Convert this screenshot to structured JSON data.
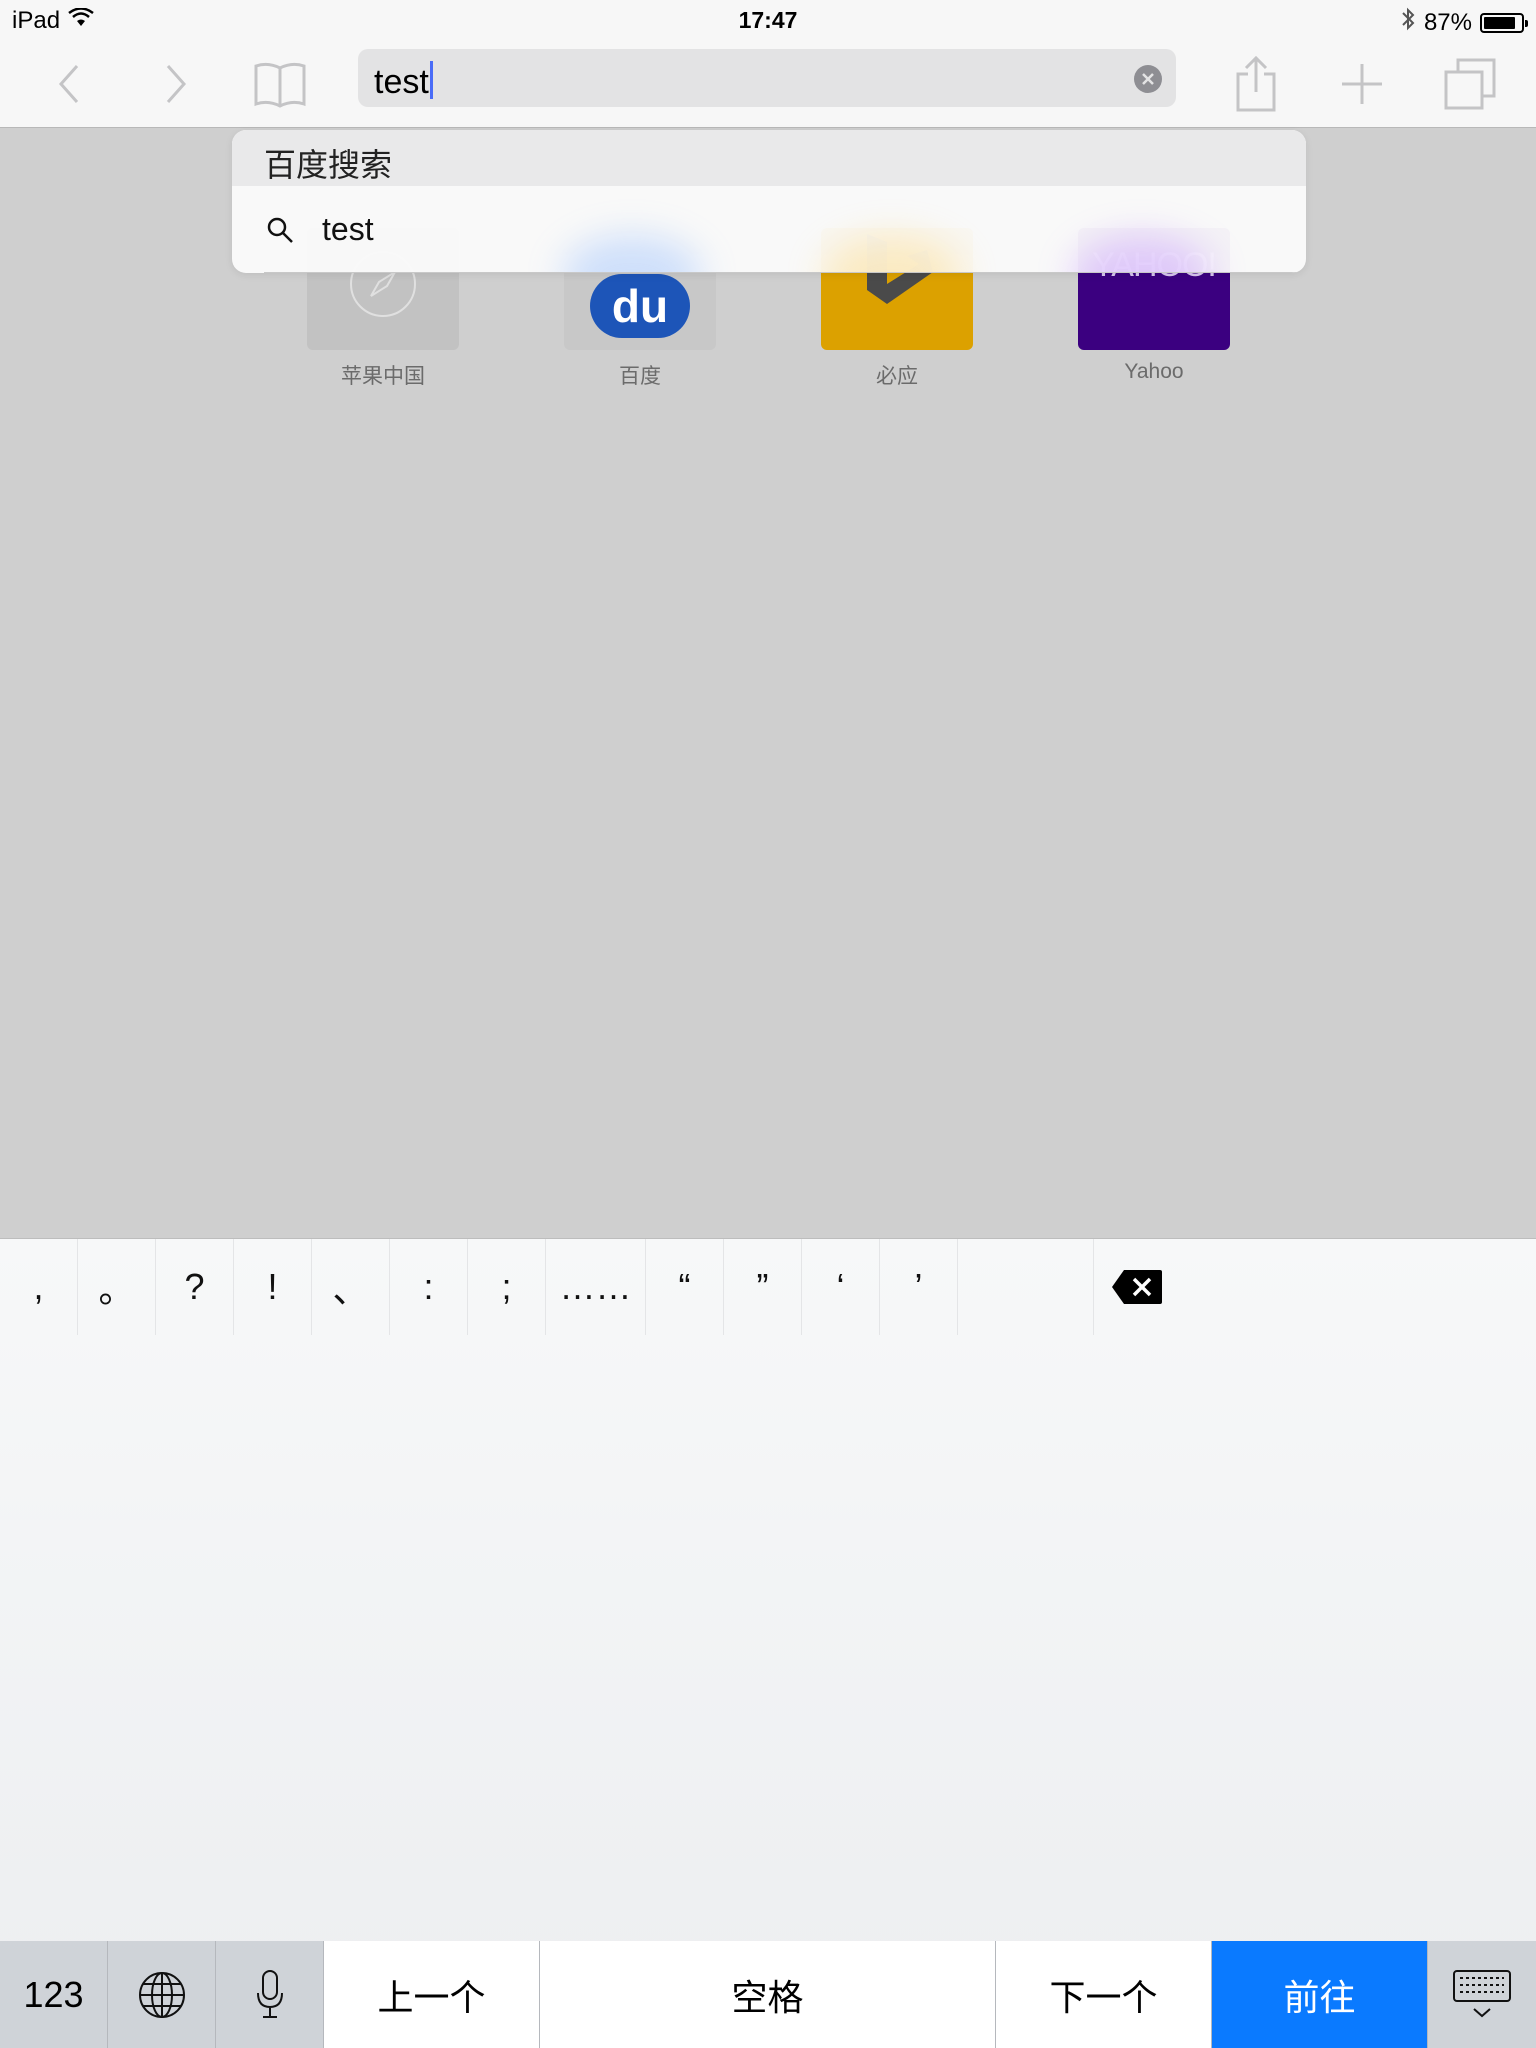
{
  "status_bar": {
    "device": "iPad",
    "time": "17:47",
    "battery_percent": "87%",
    "battery_level": 0.87
  },
  "toolbar": {
    "address_value": "test"
  },
  "suggestions": {
    "header": "百度搜索",
    "items": [
      {
        "text": "test"
      }
    ]
  },
  "favorites": [
    {
      "label": "苹果中国",
      "color": "#c2c2c2"
    },
    {
      "label": "百度",
      "color": "#c8c8c8"
    },
    {
      "label": "必应",
      "color": "#dca100"
    },
    {
      "label": "Yahoo",
      "color": "#3b0080"
    }
  ],
  "favorite_tile_text": {
    "baidu": "du",
    "yahoo": "YAHOO!"
  },
  "keyboard": {
    "punctuation": [
      ",",
      "。",
      "?",
      "!",
      "、",
      ":",
      ";",
      "……",
      "“",
      "”",
      "‘",
      "’"
    ],
    "bottom": {
      "numbers": "123",
      "prev": "上一个",
      "space": "空格",
      "next": "下一个",
      "go": "前往"
    },
    "accent_color": "#0a7aff"
  }
}
